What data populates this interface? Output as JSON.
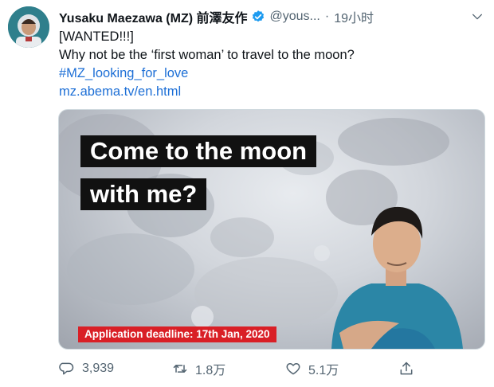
{
  "tweet": {
    "author_name": "Yusaku Maezawa (MZ) 前澤友作",
    "handle": "@yous...",
    "separator": "·",
    "time": "19小时",
    "line1": "[WANTED!!!]",
    "line2": "Why not be the ‘first woman’ to travel to the moon?",
    "hashtag": "#MZ_looking_for_love",
    "link": "mz.abema.tv/en.html"
  },
  "media": {
    "headline_line1": "Come to the moon",
    "headline_line2": "with me?",
    "deadline": "Application deadline: 17th Jan, 2020"
  },
  "actions": {
    "reply_count": "3,939",
    "retweet_count": "1.8万",
    "like_count": "5.1万"
  },
  "icons": {
    "verified": "verified-badge-icon",
    "more": "chevron-down-icon",
    "reply": "reply-icon",
    "retweet": "retweet-icon",
    "like": "heart-icon",
    "share": "share-icon"
  },
  "colors": {
    "link": "#1d6fd6",
    "verified": "#1d9bf0",
    "deadline_bg": "#d91f26",
    "headline_bg": "#111111"
  }
}
